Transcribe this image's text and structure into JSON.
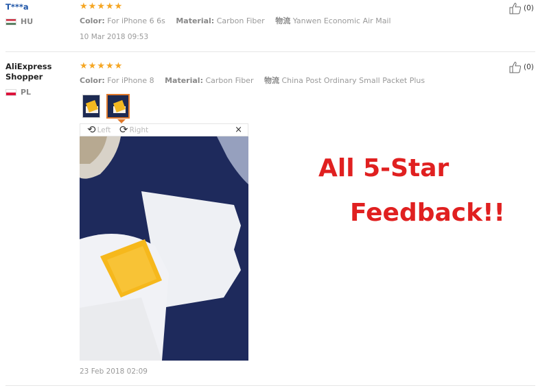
{
  "reviews": [
    {
      "user": "T***a",
      "country": "HU",
      "rating_stars": 5,
      "color_label": "Color:",
      "color_value": "For iPhone 6 6s",
      "material_label": "Material:",
      "material_value": "Carbon Fiber",
      "shipping_label": "物流",
      "shipping_value": "Yanwen Economic Air Mail",
      "date": "10 Mar 2018 09:53",
      "likes": "(0)"
    },
    {
      "user": "AliExpress Shopper",
      "country": "PL",
      "rating_stars": 5,
      "color_label": "Color:",
      "color_value": "For iPhone 8",
      "material_label": "Material:",
      "material_value": "Carbon Fiber",
      "shipping_label": "物流",
      "shipping_value": "China Post Ordinary Small Packet Plus",
      "date": "23 Feb 2018 02:09",
      "likes": "(0)",
      "viewer": {
        "rotate_left": "Left",
        "rotate_right": "Right",
        "close": "×"
      }
    }
  ],
  "promo": {
    "line1": "All 5-Star",
    "line2": "Feedback!!"
  },
  "colors": {
    "star": "#f5a623",
    "link": "#1f56a8",
    "promo": "#e02020",
    "active_thumb": "#e0792b"
  },
  "icons": {
    "like": "thumbs-up-icon",
    "star": "star-icon",
    "rotate_left": "rotate-left-icon",
    "rotate_right": "rotate-right-icon",
    "close": "close-icon"
  }
}
